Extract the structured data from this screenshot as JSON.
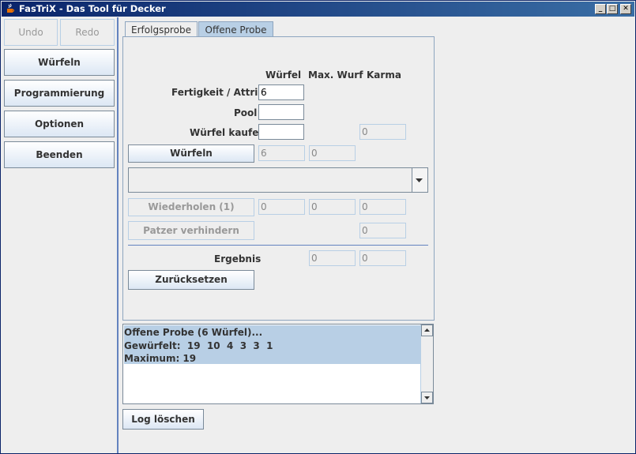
{
  "window": {
    "title": "FasTriX - Das Tool für Decker"
  },
  "sidebar": {
    "undo": "Undo",
    "redo": "Redo",
    "wuerfeln": "Würfeln",
    "programmierung": "Programmierung",
    "optionen": "Optionen",
    "beenden": "Beenden"
  },
  "tabs": {
    "tab1": "Erfolgsprobe",
    "tab2": "Offene Probe"
  },
  "columns": {
    "wuerfel": "Würfel",
    "maxwurf": "Max. Wurf",
    "karma": "Karma"
  },
  "form": {
    "fertigkeit_label": "Fertigkeit / Attribut",
    "fertigkeit_value": "6",
    "pool_label": "Pool",
    "pool_value": "",
    "kaufen_label": "Würfel kaufen",
    "kaufen_value": "",
    "kaufen_karma": "0",
    "wuerfeln_button": "Würfeln",
    "wuerfeln_wuerfel": "6",
    "wuerfeln_max": "0",
    "wiederholen_button": "Wiederholen (1)",
    "wiederholen_wuerfel": "0",
    "wiederholen_max": "0",
    "wiederholen_karma": "0",
    "patzer_button": "Patzer verhindern",
    "patzer_karma": "0",
    "ergebnis_label": "Ergebnis",
    "ergebnis_max": "0",
    "ergebnis_karma": "0",
    "reset_button": "Zurücksetzen"
  },
  "log": {
    "lines": [
      "Offene Probe (6 Würfel)...",
      "Gewürfelt:  19  10  4  3  3  1",
      "Maximum: 19"
    ],
    "clear_button": "Log löschen"
  }
}
